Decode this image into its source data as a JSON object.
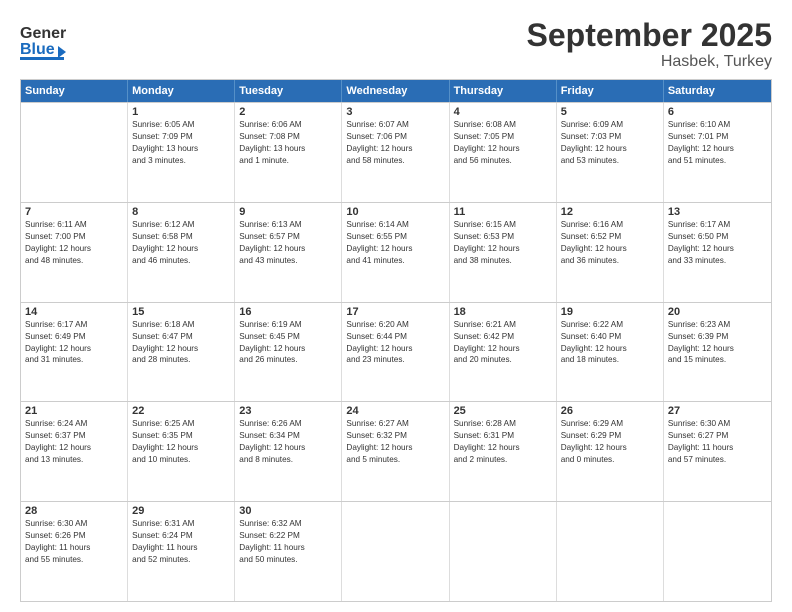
{
  "header": {
    "logo_line1": "General",
    "logo_line2": "Blue",
    "title": "September 2025",
    "subtitle": "Hasbek, Turkey"
  },
  "days": [
    "Sunday",
    "Monday",
    "Tuesday",
    "Wednesday",
    "Thursday",
    "Friday",
    "Saturday"
  ],
  "weeks": [
    [
      {
        "day": "",
        "info": ""
      },
      {
        "day": "1",
        "info": "Sunrise: 6:05 AM\nSunset: 7:09 PM\nDaylight: 13 hours\nand 3 minutes."
      },
      {
        "day": "2",
        "info": "Sunrise: 6:06 AM\nSunset: 7:08 PM\nDaylight: 13 hours\nand 1 minute."
      },
      {
        "day": "3",
        "info": "Sunrise: 6:07 AM\nSunset: 7:06 PM\nDaylight: 12 hours\nand 58 minutes."
      },
      {
        "day": "4",
        "info": "Sunrise: 6:08 AM\nSunset: 7:05 PM\nDaylight: 12 hours\nand 56 minutes."
      },
      {
        "day": "5",
        "info": "Sunrise: 6:09 AM\nSunset: 7:03 PM\nDaylight: 12 hours\nand 53 minutes."
      },
      {
        "day": "6",
        "info": "Sunrise: 6:10 AM\nSunset: 7:01 PM\nDaylight: 12 hours\nand 51 minutes."
      }
    ],
    [
      {
        "day": "7",
        "info": "Sunrise: 6:11 AM\nSunset: 7:00 PM\nDaylight: 12 hours\nand 48 minutes."
      },
      {
        "day": "8",
        "info": "Sunrise: 6:12 AM\nSunset: 6:58 PM\nDaylight: 12 hours\nand 46 minutes."
      },
      {
        "day": "9",
        "info": "Sunrise: 6:13 AM\nSunset: 6:57 PM\nDaylight: 12 hours\nand 43 minutes."
      },
      {
        "day": "10",
        "info": "Sunrise: 6:14 AM\nSunset: 6:55 PM\nDaylight: 12 hours\nand 41 minutes."
      },
      {
        "day": "11",
        "info": "Sunrise: 6:15 AM\nSunset: 6:53 PM\nDaylight: 12 hours\nand 38 minutes."
      },
      {
        "day": "12",
        "info": "Sunrise: 6:16 AM\nSunset: 6:52 PM\nDaylight: 12 hours\nand 36 minutes."
      },
      {
        "day": "13",
        "info": "Sunrise: 6:17 AM\nSunset: 6:50 PM\nDaylight: 12 hours\nand 33 minutes."
      }
    ],
    [
      {
        "day": "14",
        "info": "Sunrise: 6:17 AM\nSunset: 6:49 PM\nDaylight: 12 hours\nand 31 minutes."
      },
      {
        "day": "15",
        "info": "Sunrise: 6:18 AM\nSunset: 6:47 PM\nDaylight: 12 hours\nand 28 minutes."
      },
      {
        "day": "16",
        "info": "Sunrise: 6:19 AM\nSunset: 6:45 PM\nDaylight: 12 hours\nand 26 minutes."
      },
      {
        "day": "17",
        "info": "Sunrise: 6:20 AM\nSunset: 6:44 PM\nDaylight: 12 hours\nand 23 minutes."
      },
      {
        "day": "18",
        "info": "Sunrise: 6:21 AM\nSunset: 6:42 PM\nDaylight: 12 hours\nand 20 minutes."
      },
      {
        "day": "19",
        "info": "Sunrise: 6:22 AM\nSunset: 6:40 PM\nDaylight: 12 hours\nand 18 minutes."
      },
      {
        "day": "20",
        "info": "Sunrise: 6:23 AM\nSunset: 6:39 PM\nDaylight: 12 hours\nand 15 minutes."
      }
    ],
    [
      {
        "day": "21",
        "info": "Sunrise: 6:24 AM\nSunset: 6:37 PM\nDaylight: 12 hours\nand 13 minutes."
      },
      {
        "day": "22",
        "info": "Sunrise: 6:25 AM\nSunset: 6:35 PM\nDaylight: 12 hours\nand 10 minutes."
      },
      {
        "day": "23",
        "info": "Sunrise: 6:26 AM\nSunset: 6:34 PM\nDaylight: 12 hours\nand 8 minutes."
      },
      {
        "day": "24",
        "info": "Sunrise: 6:27 AM\nSunset: 6:32 PM\nDaylight: 12 hours\nand 5 minutes."
      },
      {
        "day": "25",
        "info": "Sunrise: 6:28 AM\nSunset: 6:31 PM\nDaylight: 12 hours\nand 2 minutes."
      },
      {
        "day": "26",
        "info": "Sunrise: 6:29 AM\nSunset: 6:29 PM\nDaylight: 12 hours\nand 0 minutes."
      },
      {
        "day": "27",
        "info": "Sunrise: 6:30 AM\nSunset: 6:27 PM\nDaylight: 11 hours\nand 57 minutes."
      }
    ],
    [
      {
        "day": "28",
        "info": "Sunrise: 6:30 AM\nSunset: 6:26 PM\nDaylight: 11 hours\nand 55 minutes."
      },
      {
        "day": "29",
        "info": "Sunrise: 6:31 AM\nSunset: 6:24 PM\nDaylight: 11 hours\nand 52 minutes."
      },
      {
        "day": "30",
        "info": "Sunrise: 6:32 AM\nSunset: 6:22 PM\nDaylight: 11 hours\nand 50 minutes."
      },
      {
        "day": "",
        "info": ""
      },
      {
        "day": "",
        "info": ""
      },
      {
        "day": "",
        "info": ""
      },
      {
        "day": "",
        "info": ""
      }
    ]
  ]
}
